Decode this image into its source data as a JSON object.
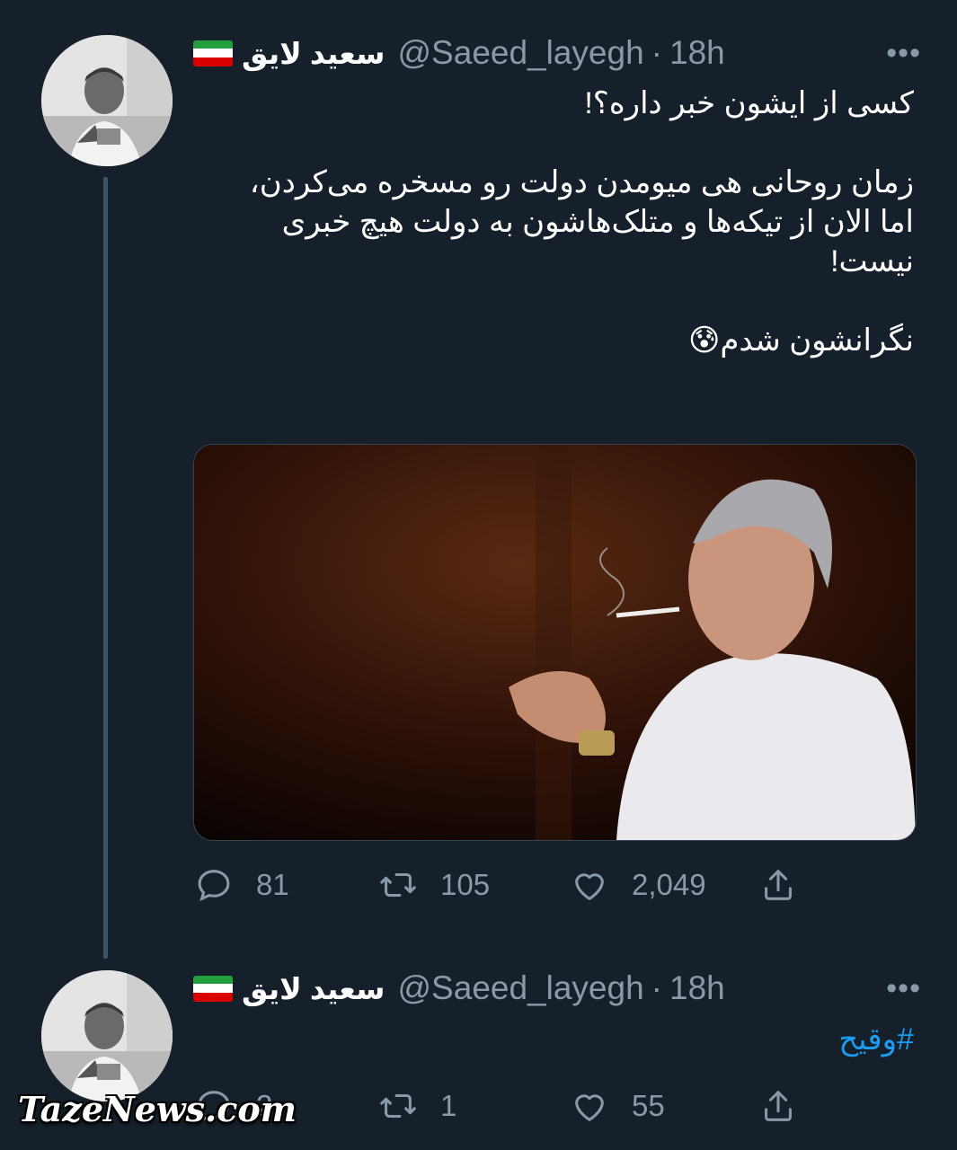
{
  "tweets": [
    {
      "display_name": "سعید لایق",
      "handle": "@Saeed_layegh",
      "separator": "·",
      "time": "18h",
      "more": "•••",
      "text": "کسی از ایشون خبر داره؟!\n\nزمان روحانی هی میومدن دولت رو مسخره می‌کردن، اما الان از تیکه‌ها و متلک‌هاشون به دولت هیچ خبری نیست!\n\nنگرانشون شدم😰",
      "reply_count": "81",
      "retweet_count": "105",
      "like_count": "2,049"
    },
    {
      "display_name": "سعید لایق",
      "handle": "@Saeed_layegh",
      "separator": "·",
      "time": "18h",
      "more": "•••",
      "hashtag": "#وقیح",
      "reply_count": "2",
      "retweet_count": "1",
      "like_count": "55"
    }
  ],
  "icons": {
    "reply": "reply-icon",
    "retweet": "retweet-icon",
    "like": "heart-icon",
    "share": "share-icon",
    "more": "more-icon",
    "flag": "iran-flag-icon"
  },
  "colors": {
    "background": "#15202b",
    "text_secondary": "#8b98a5",
    "link": "#1d9bf0",
    "thread_line": "#3d5466"
  },
  "watermark": "TazeNews.com"
}
